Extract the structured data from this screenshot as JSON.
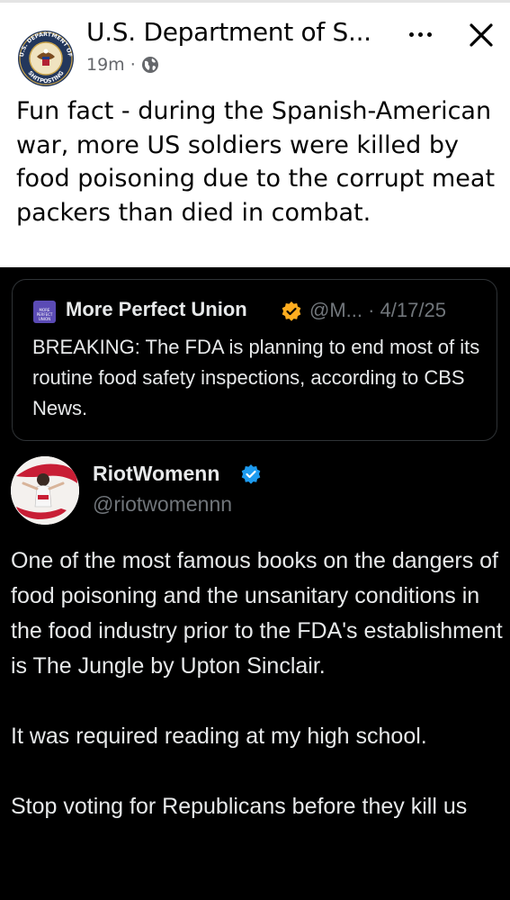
{
  "post": {
    "page_name": "U.S. Department of S...",
    "time": "19m",
    "separator": "·",
    "privacy_icon": "globe-icon",
    "text": "Fun fact - during the Spanish-American war, more US soldiers were killed by food poisoning due to the corrupt meat packers than died in combat.",
    "seal_text_top": "U.S. DEPARTMENT OF",
    "seal_text_bottom": "SHITPOSTING"
  },
  "quote": {
    "logo_text": "MORE PERFECT UNION",
    "name": "More Perfect Union",
    "handle_date": "@M... · 4/17/25",
    "text": "BREAKING: The FDA is planning to end most of its routine food safety inspections, according to CBS News."
  },
  "tweet": {
    "name": "RiotWomenn",
    "handle": "@riotwomennn",
    "paragraph1": "One of the most famous books on the dangers of food poisoning and the unsanitary conditions in the food industry prior to the FDA's establishment is The Jungle by Upton Sinclair.",
    "paragraph2": "It was required reading at my high school.",
    "paragraph3": "Stop voting for Republicans before they kill us"
  },
  "colors": {
    "verified_badge": "#ffad1f",
    "verified_blue": "#1d9bf0",
    "muted_text": "#71767b",
    "light_text": "#e7e9ea"
  }
}
